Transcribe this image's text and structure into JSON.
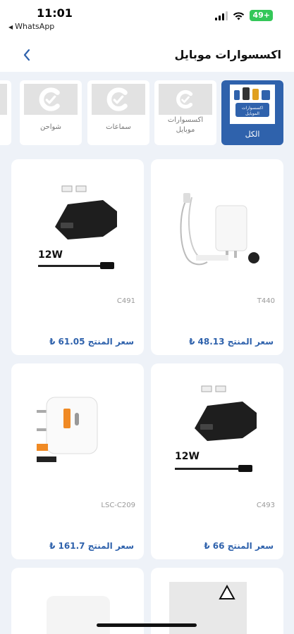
{
  "status_bar": {
    "time": "11:01",
    "back_app": "WhatsApp",
    "battery": "49+"
  },
  "header": {
    "title": "اكسسوارات موبايل",
    "back_icon": "chevron-left-icon"
  },
  "categories": [
    {
      "label": "الكل",
      "active": true,
      "thumb_text_1": "اكسسوارات",
      "thumb_text_2": "الموبايل"
    },
    {
      "label_line1": "اكسسوارات",
      "label_line2": "موبايل",
      "active": false
    },
    {
      "label": "سماعات",
      "active": false
    },
    {
      "label": "شواحن",
      "active": false
    }
  ],
  "products": [
    {
      "code": "T440",
      "price": "سعر المنتج 48.13 ₺",
      "image": "wall-charger-with-cable"
    },
    {
      "code": "C491",
      "price": "سعر المنتج 61.05 ₺",
      "image": "car-charger-with-cable",
      "watt": "12W"
    },
    {
      "code": "C493",
      "price": "سعر المنتج 66 ₺",
      "image": "car-charger-type-c",
      "watt": "12W"
    },
    {
      "code": "LSC-C209",
      "price": "سعر المنتج 161.7 ₺",
      "image": "wall-charger-pd"
    }
  ],
  "colors": {
    "accent": "#2f62ac",
    "background": "#eef2f8",
    "battery": "#34c759"
  }
}
